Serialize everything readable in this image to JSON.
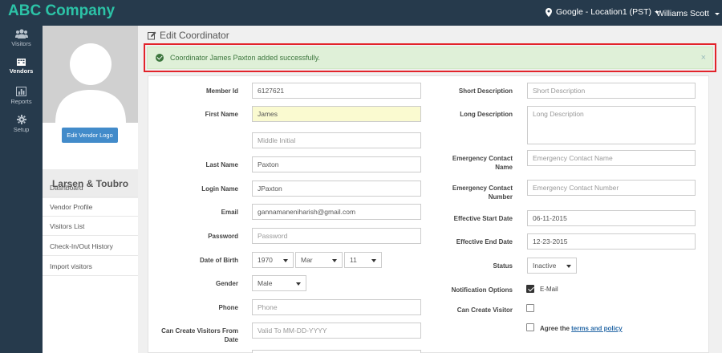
{
  "header": {
    "brand": "ABC Company",
    "location": "Google - Location1 (PST)",
    "user": "Williams Scott"
  },
  "nav": [
    {
      "label": "Visitors",
      "icon": "users-icon"
    },
    {
      "label": "Vendors",
      "icon": "building-icon"
    },
    {
      "label": "Reports",
      "icon": "bar-chart-icon"
    },
    {
      "label": "Setup",
      "icon": "gear-icon"
    }
  ],
  "sidebar": {
    "edit_logo_label": "Edit Vendor Logo",
    "vendor_name": "Larsen & Toubro",
    "menu": [
      "Dashboard",
      "Vendor Profile",
      "Visitors List",
      "Check-In/Out History",
      "Import visitors"
    ]
  },
  "page": {
    "title": "Edit Coordinator",
    "alert": "Coordinator James Paxton added successfully.",
    "alert_close": "×"
  },
  "form": {
    "member_id": {
      "label": "Member Id",
      "value": "6127621"
    },
    "first_name": {
      "label": "First Name",
      "value": "James"
    },
    "middle_initial": {
      "placeholder": "Middle Initial"
    },
    "last_name": {
      "label": "Last Name",
      "value": "Paxton"
    },
    "login_name": {
      "label": "Login Name",
      "value": "JPaxton"
    },
    "email": {
      "label": "Email",
      "value": "gannamaneniharish@gmail.com"
    },
    "password": {
      "label": "Password",
      "placeholder": "Password"
    },
    "dob": {
      "label": "Date of Birth",
      "year": "1970",
      "month": "Mar",
      "day": "11"
    },
    "gender": {
      "label": "Gender",
      "value": "Male"
    },
    "phone": {
      "label": "Phone",
      "placeholder": "Phone"
    },
    "can_create_from": {
      "label_line1": "Can Create Visitors From",
      "label_line2": "Date",
      "placeholder": "Valid To MM-DD-YYYY"
    },
    "short_desc": {
      "label": "Short Description",
      "placeholder": "Short Description"
    },
    "long_desc": {
      "label": "Long Description",
      "placeholder": "Long Description"
    },
    "emergency_name": {
      "label_line1": "Emergency Contact",
      "label_line2": "Name",
      "placeholder": "Emergency Contact Name"
    },
    "emergency_number": {
      "label_line1": "Emergency Contact",
      "label_line2": "Number",
      "placeholder": "Emergency Contact Number"
    },
    "start_date": {
      "label": "Effective Start Date",
      "value": "06-11-2015"
    },
    "end_date": {
      "label": "Effective End Date",
      "value": "12-23-2015"
    },
    "status": {
      "label": "Status",
      "value": "Inactive"
    },
    "notification": {
      "label": "Notification Options",
      "option": "E-Mail",
      "checked": true
    },
    "can_create_visitor": {
      "label": "Can Create Visitor",
      "checked": false
    },
    "agree": {
      "text": "Agree the",
      "link": "terms and policy",
      "checked": false
    }
  }
}
